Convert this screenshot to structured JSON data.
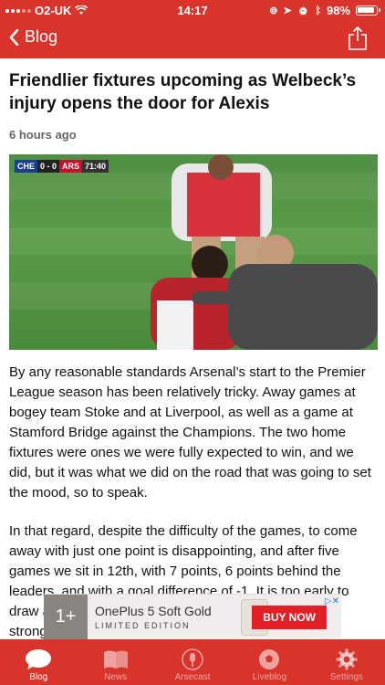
{
  "status_bar": {
    "carrier": "O2-UK",
    "time": "14:17",
    "battery": "98%"
  },
  "nav": {
    "back_label": "Blog"
  },
  "article": {
    "headline": "Friendlier fixtures upcoming as Welbeck’s injury opens the door for Alexis",
    "time_ago": "6 hours ago",
    "scorebug": {
      "team1": "CHE",
      "score": "0 - 0",
      "team2": "ARS",
      "clock": "71:40"
    },
    "paragraphs": [
      "By any reasonable standards Arsenal’s start to the Premier League season has been relatively tricky. Away games at bogey team Stoke and at Liverpool, as well as a game at Stamford Bridge against the Champions. The two home fixtures were ones we were fully expected to win, and we did, but it was what we did on the road that was going to set the mood, so to speak.",
      "In that regard, despite the difficulty of the games, to come away with just one point is disappointing, and after five games we sit in 12th, with 7 points, 6 points behind the leaders, and with a goal difference of -1. It is too early to draw any firm conclusions, but as the games is such a strong start then it is hard to think of the"
    ]
  },
  "ad": {
    "title": "OnePlus 5 Soft Gold",
    "subtitle": "LIMITED EDITION",
    "cta": "BUY NOW"
  },
  "tabs": [
    {
      "label": "Blog",
      "icon": "chat-bubble-icon",
      "active": true
    },
    {
      "label": "News",
      "icon": "book-icon",
      "active": false
    },
    {
      "label": "Arsecast",
      "icon": "microphone-icon",
      "active": false
    },
    {
      "label": "Liveblog",
      "icon": "football-icon",
      "active": false
    },
    {
      "label": "Settings",
      "icon": "gear-icon",
      "active": false
    }
  ],
  "colors": {
    "brand_red": "#d9342b"
  }
}
